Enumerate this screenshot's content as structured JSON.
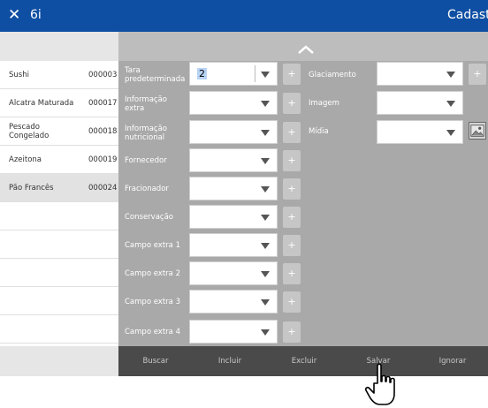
{
  "titlebar": {
    "close_icon": "close-icon",
    "app_name": "6i",
    "screen_title": "Cadastr"
  },
  "list": {
    "items": [
      {
        "name": "Sushi",
        "code": "000003"
      },
      {
        "name": "Alcatra Maturada",
        "code": "000017"
      },
      {
        "name": "Pescado Congelado",
        "code": "000018"
      },
      {
        "name": "Azeitona",
        "code": "000019"
      },
      {
        "name": "Pão Francês",
        "code": "000024",
        "selected": true
      }
    ]
  },
  "form": {
    "collapse_icon": "chevron-up-icon",
    "fields_col1": [
      {
        "label": "Tara predeterminada",
        "value": "2"
      },
      {
        "label": "Informação extra",
        "value": ""
      },
      {
        "label": "Informação nutricional",
        "value": ""
      },
      {
        "label": "Fornecedor",
        "value": ""
      },
      {
        "label": "Fracionador",
        "value": ""
      },
      {
        "label": "Conservação",
        "value": ""
      },
      {
        "label": "Campo extra 1",
        "value": ""
      },
      {
        "label": "Campo extra 2",
        "value": ""
      },
      {
        "label": "Campo extra 3",
        "value": ""
      },
      {
        "label": "Campo extra 4",
        "value": ""
      }
    ],
    "add_label": "+",
    "fields_col2": [
      {
        "label": "Glaciamento",
        "value": ""
      },
      {
        "label": "Imagem",
        "value": ""
      },
      {
        "label": "Mídia",
        "value": ""
      }
    ]
  },
  "buttons": {
    "buscar": "Buscar",
    "incluir": "Incluir",
    "excluir": "Excluir",
    "salvar": "Salvar",
    "ignorar": "Ignorar"
  },
  "colors": {
    "titlebar": "#0f4fa3",
    "panel": "#a9a9a9",
    "button_bar": "#4a4a4a"
  }
}
